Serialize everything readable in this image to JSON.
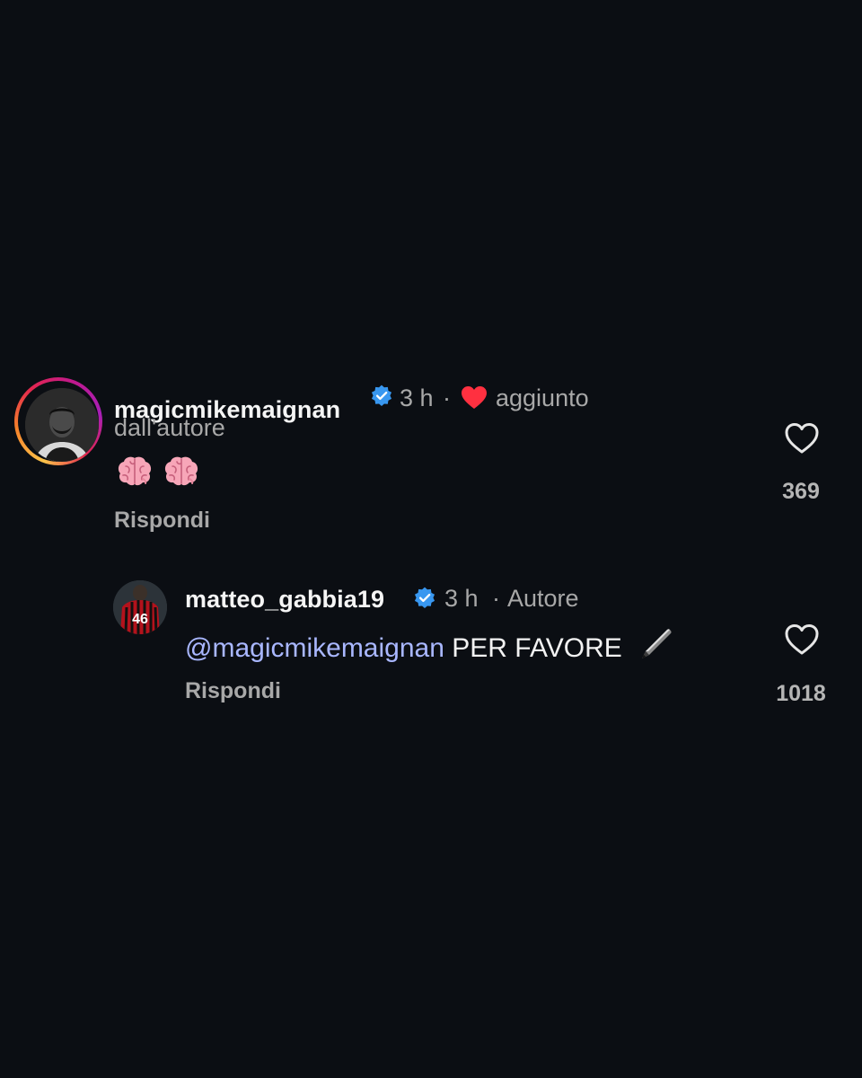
{
  "comments": [
    {
      "username": "magicmikemaignan",
      "verified": true,
      "time": "3 h",
      "separator": "·",
      "liked_by_author_part1": "aggiunto",
      "liked_by_author_part2": "dall'autore",
      "content_emoji": [
        "brain-emoji",
        "brain-emoji"
      ],
      "reply_label": "Rispondi",
      "like_count": "369"
    },
    {
      "username": "matteo_gabbia19",
      "verified": true,
      "time": "3 h",
      "separator": "·",
      "badge": "Autore",
      "mention": "@magicmikemaignan",
      "text": "PER FAVORE",
      "trailing_emoji": "pen-emoji",
      "reply_label": "Rispondi",
      "like_count": "1018",
      "avatar_jersey_number": "46"
    }
  ],
  "colors": {
    "background": "#0b0e13",
    "verified_badge": "#3897f0",
    "liked_heart": "#ff3040",
    "mention": "#a9b7ff",
    "muted_text": "#a8a8a8"
  }
}
